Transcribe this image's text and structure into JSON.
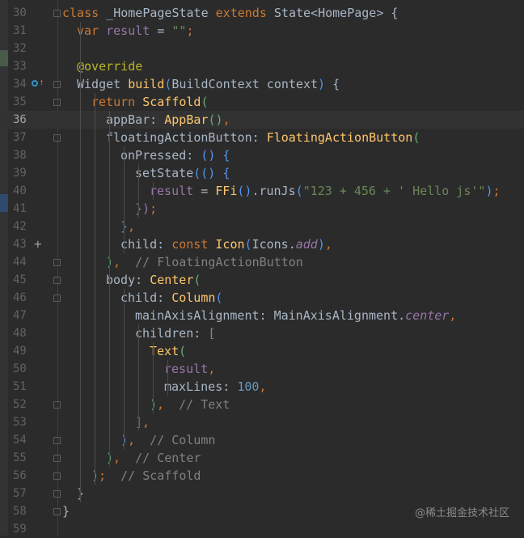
{
  "editor": {
    "current_line": 36,
    "lines": [
      {
        "n": "30",
        "indent": 0,
        "t": [
          [
            "class ",
            "kw"
          ],
          [
            "_HomePageState ",
            ""
          ],
          [
            "extends ",
            "kw"
          ],
          [
            "State<HomePage> {",
            ""
          ]
        ]
      },
      {
        "n": "31",
        "indent": 2,
        "t": [
          [
            "var ",
            "kw"
          ],
          [
            "result",
            "fld"
          ],
          [
            " = ",
            ""
          ],
          [
            "\"\"",
            "str"
          ],
          [
            ";",
            "kw"
          ]
        ]
      },
      {
        "n": "32",
        "indent": 0,
        "t": []
      },
      {
        "n": "33",
        "indent": 2,
        "t": [
          [
            "@override",
            "ann"
          ]
        ]
      },
      {
        "n": "34",
        "indent": 2,
        "t": [
          [
            "Widget ",
            ""
          ],
          [
            "build",
            "fn"
          ],
          [
            "(",
            "pb"
          ],
          [
            "BuildContext context",
            ""
          ],
          [
            ")",
            "pb"
          ],
          [
            " {",
            ""
          ]
        ]
      },
      {
        "n": "35",
        "indent": 4,
        "t": [
          [
            "return ",
            "kw"
          ],
          [
            "Scaffold",
            "fn"
          ],
          [
            "(",
            "pg"
          ]
        ]
      },
      {
        "n": "36",
        "indent": 6,
        "t": [
          [
            "appBar: ",
            ""
          ],
          [
            "AppBar",
            "fn"
          ],
          [
            "()",
            "pg"
          ],
          [
            ",",
            "kw"
          ]
        ]
      },
      {
        "n": "37",
        "indent": 6,
        "t": [
          [
            "floatingActionButton: ",
            ""
          ],
          [
            "FloatingActionButton",
            "fn"
          ],
          [
            "(",
            "pg"
          ]
        ]
      },
      {
        "n": "38",
        "indent": 8,
        "t": [
          [
            "onPressed: ",
            ""
          ],
          [
            "() {",
            "pb"
          ]
        ]
      },
      {
        "n": "39",
        "indent": 10,
        "t": [
          [
            "setState",
            ""
          ],
          [
            "(() {",
            "pb"
          ]
        ]
      },
      {
        "n": "40",
        "indent": 12,
        "t": [
          [
            "result",
            "fld"
          ],
          [
            " = ",
            ""
          ],
          [
            "FFi",
            "fn"
          ],
          [
            "()",
            "pb"
          ],
          [
            ".runJs",
            ""
          ],
          [
            "(",
            "pb"
          ],
          [
            "\"123 + 456 + ' Hello js'\"",
            "str"
          ],
          [
            ")",
            "pb"
          ],
          [
            ";",
            "kw"
          ]
        ]
      },
      {
        "n": "41",
        "indent": 10,
        "t": [
          [
            "})",
            "pp"
          ],
          [
            ";",
            "kw"
          ]
        ]
      },
      {
        "n": "42",
        "indent": 8,
        "t": [
          [
            "}",
            "pb"
          ],
          [
            ",",
            "kw"
          ]
        ]
      },
      {
        "n": "43",
        "indent": 8,
        "t": [
          [
            "child: ",
            ""
          ],
          [
            "const ",
            "kw"
          ],
          [
            "Icon",
            "fn"
          ],
          [
            "(",
            "pb"
          ],
          [
            "Icons.",
            ""
          ],
          [
            "add",
            "fld it"
          ],
          [
            ")",
            "pb"
          ],
          [
            ",",
            "kw"
          ]
        ]
      },
      {
        "n": "44",
        "indent": 6,
        "t": [
          [
            ")",
            "pg"
          ],
          [
            ",",
            "kw"
          ],
          [
            "  // FloatingActionButton",
            "cm"
          ]
        ]
      },
      {
        "n": "45",
        "indent": 6,
        "t": [
          [
            "body: ",
            ""
          ],
          [
            "Center",
            "fn"
          ],
          [
            "(",
            "pg"
          ]
        ]
      },
      {
        "n": "46",
        "indent": 8,
        "t": [
          [
            "child: ",
            ""
          ],
          [
            "Column",
            "fn"
          ],
          [
            "(",
            "pb"
          ]
        ]
      },
      {
        "n": "47",
        "indent": 10,
        "t": [
          [
            "mainAxisAlignment: ",
            ""
          ],
          [
            "MainAxisAlignment.",
            ""
          ],
          [
            "center",
            "fld it"
          ],
          [
            ",",
            "kw"
          ]
        ]
      },
      {
        "n": "48",
        "indent": 10,
        "t": [
          [
            "children: ",
            ""
          ],
          [
            "[",
            "pp"
          ]
        ]
      },
      {
        "n": "49",
        "indent": 12,
        "t": [
          [
            "Text",
            "fn"
          ],
          [
            "(",
            "pg"
          ]
        ]
      },
      {
        "n": "50",
        "indent": 14,
        "t": [
          [
            "result",
            "fld"
          ],
          [
            ",",
            "kw"
          ]
        ]
      },
      {
        "n": "51",
        "indent": 14,
        "t": [
          [
            "maxLines: ",
            ""
          ],
          [
            "100",
            "num-lit"
          ],
          [
            ",",
            "kw"
          ]
        ]
      },
      {
        "n": "52",
        "indent": 12,
        "t": [
          [
            ")",
            "pg"
          ],
          [
            ",",
            "kw"
          ],
          [
            "  // Text",
            "cm"
          ]
        ]
      },
      {
        "n": "53",
        "indent": 10,
        "t": [
          [
            "]",
            "pp"
          ],
          [
            ",",
            "kw"
          ]
        ]
      },
      {
        "n": "54",
        "indent": 8,
        "t": [
          [
            ")",
            "pb"
          ],
          [
            ",",
            "kw"
          ],
          [
            "  // Column",
            "cm"
          ]
        ]
      },
      {
        "n": "55",
        "indent": 6,
        "t": [
          [
            ")",
            "pg"
          ],
          [
            ",",
            "kw"
          ],
          [
            "  // Center",
            "cm"
          ]
        ]
      },
      {
        "n": "56",
        "indent": 4,
        "t": [
          [
            ")",
            "pg"
          ],
          [
            ";",
            "kw"
          ],
          [
            "  // Scaffold",
            "cm"
          ]
        ]
      },
      {
        "n": "57",
        "indent": 2,
        "t": [
          [
            "}",
            ""
          ]
        ]
      },
      {
        "n": "58",
        "indent": 0,
        "t": [
          [
            "}",
            ""
          ]
        ]
      },
      {
        "n": "59",
        "indent": 0,
        "t": []
      }
    ]
  },
  "watermark": "@稀土掘金技术社区"
}
